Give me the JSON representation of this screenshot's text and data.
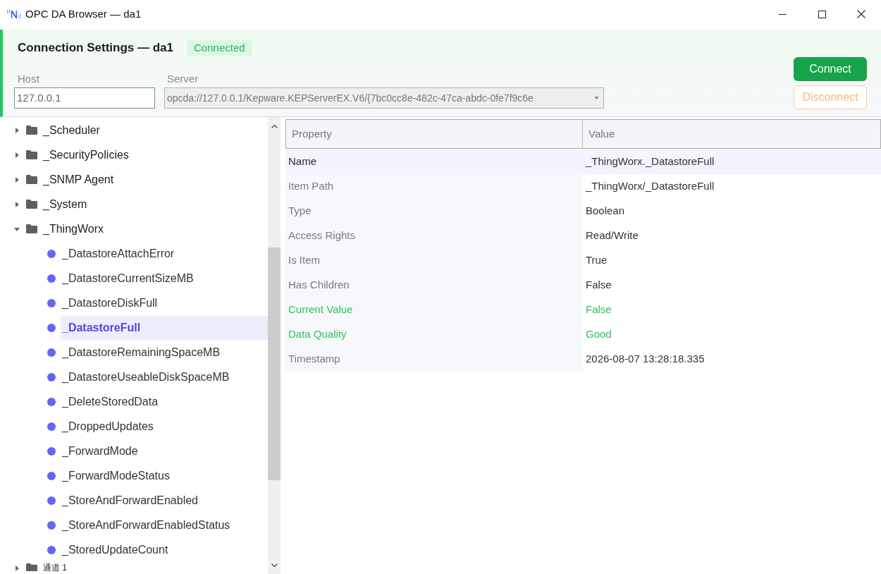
{
  "window": {
    "title": "OPC DA Browser — da1"
  },
  "connection": {
    "title": "Connection Settings — da1",
    "status": {
      "label": "Connected",
      "kind": "connected"
    },
    "host": {
      "label": "Host",
      "value": "127.0.0.1"
    },
    "server": {
      "label": "Server",
      "value": "opcda://127.0.0.1/Kepware.KEPServerEX.V6/{7bc0cc8e-482c-47ca-abdc-0fe7f9c6e",
      "disabled": true
    },
    "buttons": [
      {
        "label": "Connect",
        "kind": "primary",
        "disabled": false
      },
      {
        "label": "Disconnect",
        "kind": "warning",
        "disabled": true
      }
    ]
  },
  "tree": {
    "items": [
      {
        "label": "_Scheduler",
        "kind": "folder",
        "expanded": false,
        "selected": false
      },
      {
        "label": "_SecurityPolicies",
        "kind": "folder",
        "expanded": false,
        "selected": false
      },
      {
        "label": "_SNMP Agent",
        "kind": "folder",
        "expanded": false,
        "selected": false
      },
      {
        "label": "_System",
        "kind": "folder",
        "expanded": false,
        "selected": false
      },
      {
        "label": "_ThingWorx",
        "kind": "folder",
        "expanded": true,
        "selected": false,
        "children": [
          {
            "label": "_DatastoreAttachError",
            "kind": "tag",
            "selected": false
          },
          {
            "label": "_DatastoreCurrentSizeMB",
            "kind": "tag",
            "selected": false
          },
          {
            "label": "_DatastoreDiskFull",
            "kind": "tag",
            "selected": false
          },
          {
            "label": "_DatastoreFull",
            "kind": "tag",
            "selected": true
          },
          {
            "label": "_DatastoreRemainingSpaceMB",
            "kind": "tag",
            "selected": false
          },
          {
            "label": "_DatastoreUseableDiskSpaceMB",
            "kind": "tag",
            "selected": false
          },
          {
            "label": "_DeleteStoredData",
            "kind": "tag",
            "selected": false
          },
          {
            "label": "_DroppedUpdates",
            "kind": "tag",
            "selected": false
          },
          {
            "label": "_ForwardMode",
            "kind": "tag",
            "selected": false
          },
          {
            "label": "_ForwardModeStatus",
            "kind": "tag",
            "selected": false
          },
          {
            "label": "_StoreAndForwardEnabled",
            "kind": "tag",
            "selected": false
          },
          {
            "label": "_StoreAndForwardEnabledStatus",
            "kind": "tag",
            "selected": false
          },
          {
            "label": "_StoredUpdateCount",
            "kind": "tag",
            "selected": false
          }
        ]
      },
      {
        "label": "通道 1",
        "kind": "folder",
        "expanded": false,
        "selected": false
      }
    ]
  },
  "properties": {
    "columns": [
      "Property",
      "Value"
    ],
    "rows": [
      {
        "property": "Name",
        "value": "_ThingWorx._DatastoreFull",
        "kind": "plain",
        "selected": true
      },
      {
        "property": "Item Path",
        "value": "_ThingWorx/_DatastoreFull",
        "kind": "plain",
        "selected": false
      },
      {
        "property": "Type",
        "value": "Boolean",
        "kind": "plain",
        "selected": false
      },
      {
        "property": "Access Rights",
        "value": "Read/Write",
        "kind": "plain",
        "selected": false
      },
      {
        "property": "Is Item",
        "value": "True",
        "kind": "plain",
        "selected": false
      },
      {
        "property": "Has Children",
        "value": "False",
        "kind": "plain",
        "selected": false
      },
      {
        "property": "Current Value",
        "value": "False",
        "kind": "good",
        "selected": false
      },
      {
        "property": "Data Quality",
        "value": "Good",
        "kind": "good",
        "selected": false
      },
      {
        "property": "Timestamp",
        "value": "2026-08-07 13:28:18.335",
        "kind": "plain",
        "selected": false
      }
    ]
  }
}
